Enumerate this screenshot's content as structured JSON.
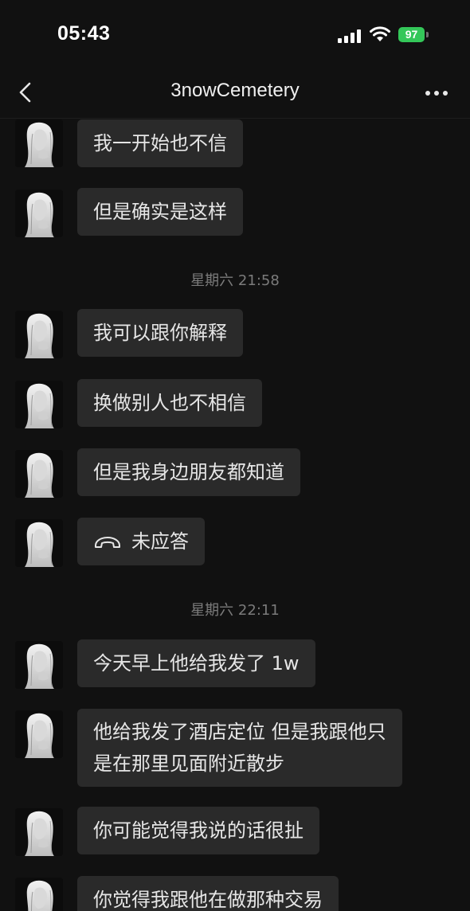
{
  "status_bar": {
    "time": "05:43",
    "battery": "97"
  },
  "header": {
    "title": "3nowCemetery"
  },
  "messages": [
    {
      "text": "我一开始也不信"
    },
    {
      "text": "但是确实是这样"
    },
    {
      "text": "我可以跟你解释"
    },
    {
      "text": "换做别人也不相信"
    },
    {
      "text": "但是我身边朋友都知道"
    },
    {
      "text": "未应答"
    },
    {
      "text": "今天早上他给我发了 1w"
    },
    {
      "text": "他给我发了酒店定位 但是我跟他只是在那里见面附近散步"
    },
    {
      "text": "你可能觉得我说的话很扯"
    },
    {
      "text": "你觉得我跟他在做那种交易"
    }
  ],
  "timestamps": [
    "星期六 21:58",
    "星期六 22:11"
  ],
  "icons": {
    "back": "chevron-left-icon",
    "more": "ellipsis-icon",
    "call": "missed-call-icon"
  }
}
